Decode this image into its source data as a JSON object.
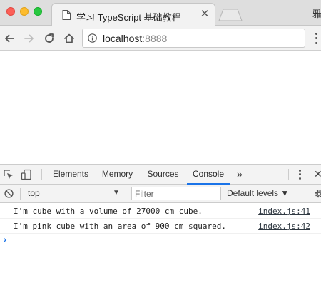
{
  "browser": {
    "tab_title": "学习 TypeScript 基础教程",
    "tab_close": "✕",
    "profile_glyph": "雅",
    "url_host": "localhost",
    "url_port": ":8888"
  },
  "devtools": {
    "tabs": [
      {
        "label": "Elements",
        "active": false
      },
      {
        "label": "Memory",
        "active": false
      },
      {
        "label": "Sources",
        "active": false
      },
      {
        "label": "Console",
        "active": true
      }
    ],
    "more_tabs": "»",
    "close": "✕",
    "context": "top",
    "context_arrow": "▼",
    "filter_placeholder": "Filter",
    "levels": "Default levels ▼",
    "accent_color": "#1a73e8"
  },
  "console": {
    "messages": [
      {
        "text": "I'm cube with a volume of 27000 cm cube.",
        "source": "index.js:41"
      },
      {
        "text": "I'm pink cube with an area of 900 cm squared.",
        "source": "index.js:42"
      }
    ],
    "prompt": "›"
  },
  "icons": {
    "window_close": "red-circle",
    "window_minimize": "yellow-circle",
    "window_maximize": "green-circle",
    "favicon": "document-icon",
    "back": "arrow-left-icon",
    "forward": "arrow-right-icon",
    "reload": "reload-icon",
    "home": "home-icon",
    "info": "info-icon",
    "inspect": "inspect-element-icon",
    "device": "device-toolbar-icon",
    "clear": "clear-console-icon",
    "settings": "gear-icon"
  }
}
